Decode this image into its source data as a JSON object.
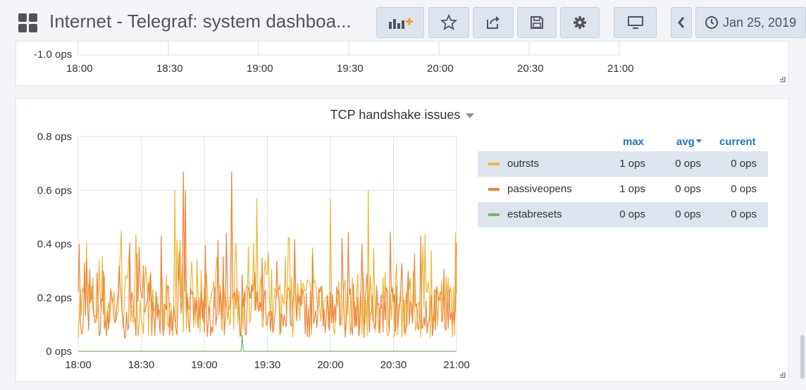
{
  "header": {
    "title": "Internet - Telegraf: system dashboa...",
    "time_range_label": "Jan 25, 2019",
    "icons": [
      "apps-icon",
      "add-panel-icon",
      "star-icon",
      "share-icon",
      "save-icon",
      "gear-icon",
      "tv-icon",
      "chevron-left-icon",
      "clock-icon"
    ],
    "accent_color": "#ff9830"
  },
  "top_panel": {
    "y_tick": "-1.0 ops",
    "x_ticks": [
      "18:00",
      "18:30",
      "19:00",
      "19:30",
      "20:00",
      "20:30",
      "21:00"
    ]
  },
  "main_panel": {
    "title": "TCP handshake issues",
    "legend": {
      "headers": {
        "max": "max",
        "avg": "avg",
        "current": "current"
      },
      "rows": [
        {
          "name": "outrsts",
          "max": "1 ops",
          "avg": "0 ops",
          "current": "0 ops",
          "color": "#eab839"
        },
        {
          "name": "passiveopens",
          "max": "1 ops",
          "avg": "0 ops",
          "current": "0 ops",
          "color": "#ef843c"
        },
        {
          "name": "estabresets",
          "max": "0 ops",
          "avg": "0 ops",
          "current": "0 ops",
          "color": "#7eb26d"
        }
      ]
    }
  },
  "chart_data": {
    "type": "line",
    "title": "TCP handshake issues",
    "x_ticks": [
      "18:00",
      "18:30",
      "19:00",
      "19:30",
      "20:00",
      "20:30",
      "21:00"
    ],
    "y_ticks": [
      "0 ops",
      "0.2 ops",
      "0.4 ops",
      "0.6 ops",
      "0.8 ops"
    ],
    "x_range": [
      "18:00",
      "21:00"
    ],
    "ylim": [
      0,
      0.8
    ],
    "grid": true,
    "legend_position": "right",
    "series": [
      {
        "name": "outrsts",
        "color": "#eab839",
        "summary": {
          "max": 0.65,
          "typical_range": [
            0.05,
            0.3
          ]
        },
        "peaks": [
          {
            "x": "18:46",
            "y": 0.6
          },
          {
            "x": "19:13",
            "y": 0.65
          },
          {
            "x": "19:25",
            "y": 0.57
          },
          {
            "x": "20:00",
            "y": 0.57
          },
          {
            "x": "20:18",
            "y": 0.6
          }
        ]
      },
      {
        "name": "passiveopens",
        "color": "#ef843c",
        "summary": {
          "max": 0.67,
          "typical_range": [
            0.05,
            0.25
          ]
        },
        "peaks": [
          {
            "x": "18:50",
            "y": 0.67
          },
          {
            "x": "18:51",
            "y": 0.6
          },
          {
            "x": "19:13",
            "y": 0.67
          },
          {
            "x": "20:43",
            "y": 0.43
          }
        ]
      },
      {
        "name": "estabresets",
        "color": "#7eb26d",
        "values_constant": 0,
        "spikes": [
          {
            "x": "19:18",
            "y": 0.06
          }
        ]
      }
    ]
  }
}
